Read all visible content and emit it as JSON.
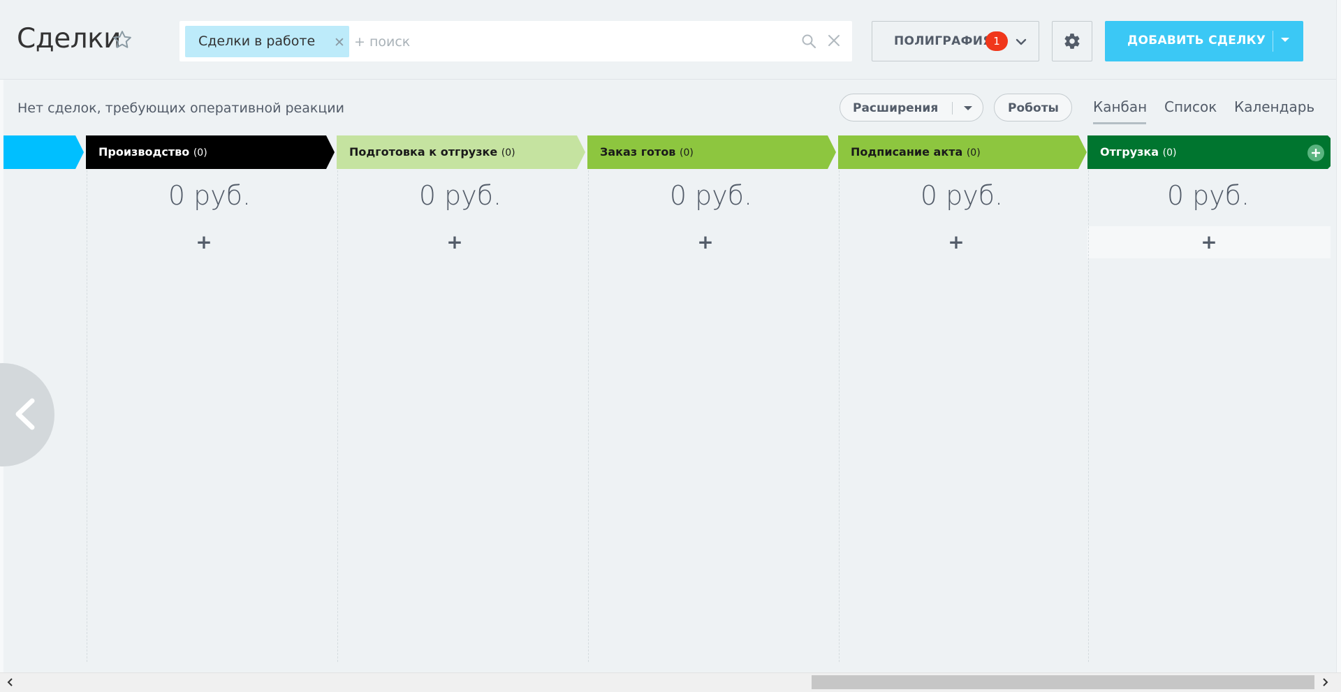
{
  "header": {
    "title": "Сделки",
    "search": {
      "filter_chip": "Сделки в работе",
      "placeholder": "+ поиск"
    },
    "category_button": {
      "label": "ПОЛИГРАФИЯ",
      "badge": "1"
    },
    "add_button": {
      "label": "ДОБАВИТЬ СДЕЛКУ"
    }
  },
  "toolbar": {
    "status_text": "Нет сделок, требующих оперативной реакции",
    "extensions_label": "Расширения",
    "robots_label": "Роботы",
    "views": [
      "Канбан",
      "Список",
      "Календарь"
    ],
    "active_view": "Канбан"
  },
  "stages": [
    {
      "name": "Производство",
      "count": "(0)",
      "sum": "0 руб.",
      "color": "#000000",
      "text_color": "#ffffff"
    },
    {
      "name": "Подготовка к отгрузке",
      "count": "(0)",
      "sum": "0 руб.",
      "color": "#c5e3a0",
      "text_color": "#1a1a1a"
    },
    {
      "name": "Заказ готов",
      "count": "(0)",
      "sum": "0 руб.",
      "color": "#8dc63f",
      "text_color": "#1a1a1a"
    },
    {
      "name": "Подписание акта",
      "count": "(0)",
      "sum": "0 руб.",
      "color": "#8dc63f",
      "text_color": "#1a1a1a"
    },
    {
      "name": "Отгрузка",
      "count": "(0)",
      "sum": "0 руб.",
      "color": "#00752f",
      "text_color": "#ffffff"
    }
  ],
  "previous_stage_color": "#00bfff",
  "quick_add_symbol": "+",
  "colors": {
    "accent": "#3bc8f5",
    "badge": "#f0371b",
    "chip": "#bdebfa"
  },
  "icons": [
    "star-icon",
    "search-icon",
    "close-icon",
    "chevron-down-icon",
    "gear-icon",
    "plus-circle-icon",
    "chevron-left-icon"
  ]
}
